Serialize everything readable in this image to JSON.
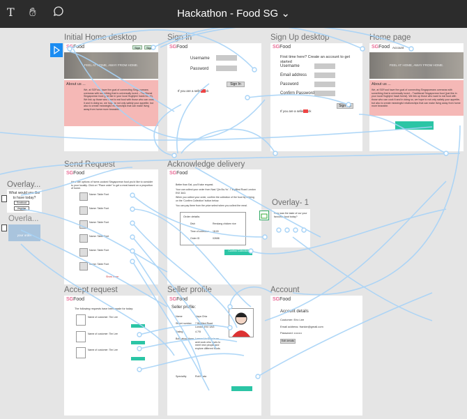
{
  "header": {
    "title": "Hackathon - Food SG",
    "chevron": "⌄"
  },
  "tools": [
    "text-tool-icon",
    "hand-tool-icon",
    "comment-tool-icon"
  ],
  "brand": {
    "sg": "SG",
    "food": "Food"
  },
  "frames": {
    "initial_home": {
      "label": "Initial Home desktop",
      "nav_btn1": "Sign",
      "nav_btn2": "Sign",
      "hero": "FEEL AT HOME, AWAY FROM HOME.",
      "about_title": "About us ...",
      "about_text": "We, at SGFood have the goal of connecting Singaporeans overseas with something that is universally loved – Traditional Singaporean food (just like in your local Hughjen/ hawk forest). We link up those who want to eat food with those who can cook it and in doing so, we hope to not only satisfy your appetite, but also to create meaningful relationships that can make living away from home more bearable."
    },
    "sign_in": {
      "label": "Sign in",
      "username": "Username",
      "password": "Password",
      "button": "Sign In",
      "no_account": "If you are a seller click"
    },
    "sign_up": {
      "label": "Sign Up desktop",
      "heading": "First time here? Create an account to get started",
      "username": "Username",
      "email": "Email address",
      "password": "Password",
      "confirm": "Confirm Password",
      "seller_note": "If you are a seller click",
      "button": "Sign Up"
    },
    "home_page": {
      "label": "Home page",
      "account": "Account",
      "hero": "FEEL AT HOME, AWAY FROM HOME.",
      "about_title": "About us ...",
      "about_text": "We, at SGFood have the goal of connecting Singaporeans overseas with something that is universally loved – Traditional Singaporean food (just like in your local Hughjen/ hawk forest). We link up those who want to eat food with those who can cook it and in doing so, we hope to not only satisfy your appetite, but also to create meaningful relationships that can make living away from home more bearable."
    },
    "send_request": {
      "label": "Send Request",
      "intro": "Here are options of home-cooked Singaporean food you'd like to consider to your locality. Click on \"Place order\" to get a meal based on a proportion of home.",
      "rows": [
        "Name: Table Font",
        "Name: Table Font",
        "Name: Table Font",
        "Name: Table Font",
        "Name: Table Font",
        "Name: Table Font"
      ],
      "more": "Show more"
    },
    "acknowledge": {
      "label": "Acknowledge delivery",
      "line1": "Better than Eat, you'll take request.",
      "line2": "Your can collect your order from Nasi 'Qin Bu-Yu'. 7 Bigfilled Road London E92 3AG.",
      "line3": "When you collect your order, confirm the collection of the food by clicking on the 'Confirm Collection' button below.",
      "line4": "You can pay there from the price select when you collect the meal.",
      "order_title": "Order details:",
      "k1": "Dish",
      "v1": "Rendang chicken rice",
      "k2": "Time of collection",
      "v2": "18:00",
      "k3": "Order ID",
      "v3": "02658",
      "button": "Confirm Collection"
    },
    "overlay": {
      "label": "Overlay...",
      "question": "What would you like to have today?",
      "opt1": "Seafood",
      "opt2": "Vegetar",
      "label2": "Overla...",
      "btn": "your order"
    },
    "overlay1": {
      "label": "Overlay- 1",
      "text": "How was the taste of our your favourite food today?"
    },
    "accept": {
      "label": "Accept request",
      "intro": "The following requests have been made for today:",
      "rows": [
        "Name of customer: Tim Lee",
        "Name of customer: Tim Lee",
        "Name of customer: Tim Lee"
      ]
    },
    "seller": {
      "label": "Seller profile",
      "title": "Seller profile:",
      "k1": "Name",
      "v1": "Maya Chia",
      "k2": "Street number",
      "v2": "7 Bigfilled Road London E92 3AG",
      "k3": "Rating",
      "v3": "4.7/5",
      "k4": "Bold about them",
      "v4": "Lemon Lin Chia is an avid cook who loves to meet new people and explore different foods.",
      "k5": "Speciality",
      "v5": "Roti Prata"
    },
    "account": {
      "label": "Account",
      "title": "Account details",
      "name": "Customer: Eric Lee",
      "email": "Email address: frankie@gmail.com",
      "password": "Password: ••••••••",
      "button": "Edit details"
    }
  }
}
